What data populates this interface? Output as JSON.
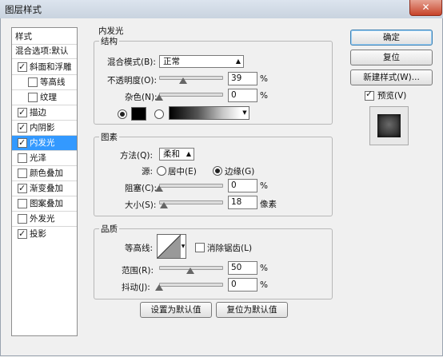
{
  "window": {
    "title": "图层样式",
    "close": "✕"
  },
  "left_panel": {
    "items": [
      {
        "label": "样式",
        "checkbox": false,
        "checked": false,
        "indent": false,
        "selected": false
      },
      {
        "label": "混合选项:默认",
        "checkbox": false,
        "checked": false,
        "indent": false,
        "selected": false
      },
      {
        "label": "斜面和浮雕",
        "checkbox": true,
        "checked": true,
        "indent": false,
        "selected": false
      },
      {
        "label": "等高线",
        "checkbox": true,
        "checked": false,
        "indent": true,
        "selected": false
      },
      {
        "label": "纹理",
        "checkbox": true,
        "checked": false,
        "indent": true,
        "selected": false
      },
      {
        "label": "描边",
        "checkbox": true,
        "checked": true,
        "indent": false,
        "selected": false
      },
      {
        "label": "内阴影",
        "checkbox": true,
        "checked": true,
        "indent": false,
        "selected": false
      },
      {
        "label": "内发光",
        "checkbox": true,
        "checked": true,
        "indent": false,
        "selected": true
      },
      {
        "label": "光泽",
        "checkbox": true,
        "checked": false,
        "indent": false,
        "selected": false
      },
      {
        "label": "颜色叠加",
        "checkbox": true,
        "checked": false,
        "indent": false,
        "selected": false
      },
      {
        "label": "渐变叠加",
        "checkbox": true,
        "checked": true,
        "indent": false,
        "selected": false
      },
      {
        "label": "图案叠加",
        "checkbox": true,
        "checked": false,
        "indent": false,
        "selected": false
      },
      {
        "label": "外发光",
        "checkbox": true,
        "checked": false,
        "indent": false,
        "selected": false
      },
      {
        "label": "投影",
        "checkbox": true,
        "checked": true,
        "indent": false,
        "selected": false
      }
    ]
  },
  "inner_glow": {
    "section_title": "内发光",
    "structure": {
      "title": "结构",
      "blend_mode_label": "混合模式(B):",
      "blend_mode_value": "正常",
      "opacity_label": "不透明度(O):",
      "opacity_value": "39",
      "opacity_fraction": 0.39,
      "noise_label": "杂色(N):",
      "noise_value": "0",
      "noise_fraction": 0,
      "percent": "%"
    },
    "elements": {
      "title": "图素",
      "method_label": "方法(Q):",
      "method_value": "柔和",
      "source_label": "源:",
      "source_center": "居中(E)",
      "source_edge": "边缘(G)",
      "choke_label": "阻塞(C):",
      "choke_value": "0",
      "choke_fraction": 0,
      "size_label": "大小(S):",
      "size_value": "18",
      "size_fraction": 0.072,
      "size_unit": "像素",
      "percent": "%"
    },
    "quality": {
      "title": "品质",
      "contour_label": "等高线:",
      "antialias_label": "消除锯齿(L)",
      "range_label": "范围(R):",
      "range_value": "50",
      "range_fraction": 0.5,
      "jitter_label": "抖动(J):",
      "jitter_value": "0",
      "jitter_fraction": 0,
      "percent": "%"
    },
    "make_default": "设置为默认值",
    "reset_default": "复位为默认值"
  },
  "buttons": {
    "ok": "确定",
    "reset": "复位",
    "new_style": "新建样式(W)...",
    "preview_label": "预览(V)"
  }
}
